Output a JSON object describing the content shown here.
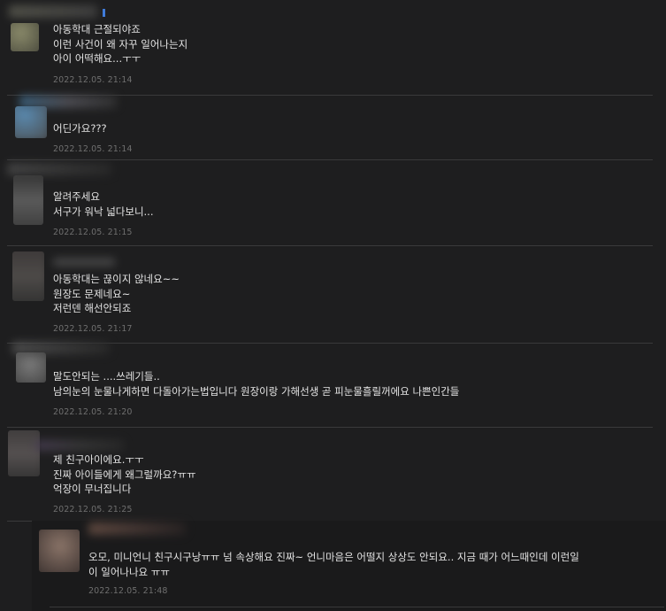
{
  "comments": [
    {
      "lines": [
        "아동학대 근절되야죠",
        "이런 사건이 왜 자꾸 일어나는지",
        "아이 어떡해요...ㅜㅜ"
      ],
      "date": "2022.12.05. 21:14",
      "avatar_color": "#5a5a4a"
    },
    {
      "lines": [
        "어딘가요???"
      ],
      "date": "2022.12.05. 21:14",
      "avatar_color": "#3a5a7a"
    },
    {
      "lines": [
        "알려주세요",
        "서구가 워낙 넓다보니..."
      ],
      "date": "2022.12.05. 21:15",
      "avatar_color": "#4a4a4a"
    },
    {
      "lines": [
        "아동학대는 끊이지 않네요~~",
        "원장도 문제네요~",
        "저런덴 해선안되죠"
      ],
      "date": "2022.12.05. 21:17",
      "avatar_color": "#4a4644"
    },
    {
      "lines": [
        "말도안되는 ....쓰레기들..",
        "남의눈의 눈물나게하면 다돌아가는법입니다 원장이랑 가해선생 곧 피눈물흘릴꺼에요 나쁜인간들"
      ],
      "date": "2022.12.05. 21:20",
      "avatar_color": "#555555"
    },
    {
      "lines": [
        "제 친구아이에요.ㅜㅜ",
        "진짜 아이들에게 왜그럴까요?ㅠㅠ",
        "억장이 무너집니다"
      ],
      "date": "2022.12.05. 21:25",
      "avatar_color": "#4d4a4a"
    }
  ],
  "reply": {
    "lines": [
      "오모, 미니언니 친구시구낭ㅠㅠ 넘 속상해요 진짜~ 언니마음은 어떨지 상상도 안되요.. 지금 때가 어느때인데 이런일",
      "이 일어나나요 ㅠㅠ"
    ],
    "date": "2022.12.05. 21:48",
    "avatar_color": "#6a5a52"
  }
}
